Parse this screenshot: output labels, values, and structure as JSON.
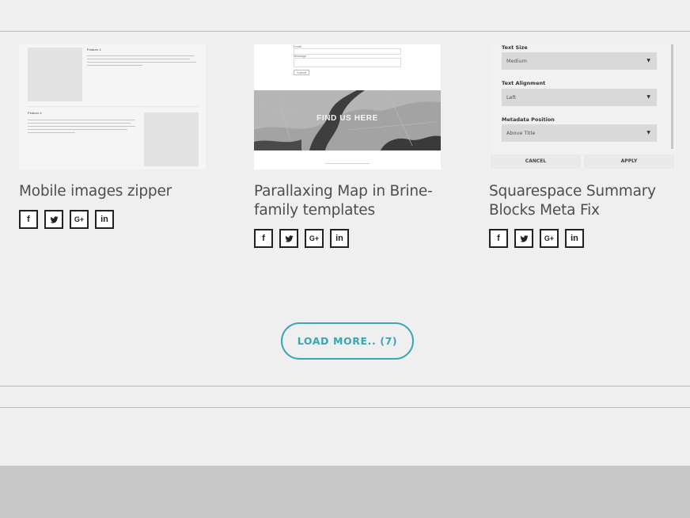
{
  "posts": [
    {
      "title": "Mobile images zipper",
      "thumb": {
        "feature1": "Feature 1",
        "feature2": "Feature 2"
      }
    },
    {
      "title": "Parallaxing Map in Brine-family templates",
      "thumb": {
        "email": "Email",
        "message": "Message",
        "submit": "Submit",
        "map_text": "FIND US HERE"
      }
    },
    {
      "title": "Squarespace Summary Blocks Meta Fix",
      "thumb": {
        "text_size_label": "Text Size",
        "text_size_value": "Medium",
        "text_alignment_label": "Text Alignment",
        "text_alignment_value": "Left",
        "metadata_position_label": "Metadata Position",
        "metadata_position_value": "Above Title",
        "cancel": "CANCEL",
        "apply": "APPLY"
      }
    }
  ],
  "share": {
    "facebook": "f",
    "twitter": "twitter-icon",
    "google": "G+",
    "linkedin": "in"
  },
  "load_more": {
    "label": "LOAD MORE..",
    "count": "(7)"
  },
  "colors": {
    "accent": "#3aa6b4",
    "background": "#efefef",
    "footer": "#c8c8c8"
  }
}
